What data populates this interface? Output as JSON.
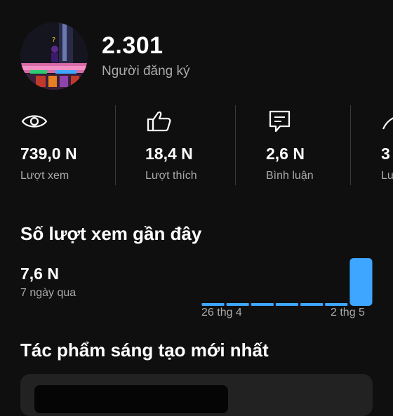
{
  "channel": {
    "subscriber_count": "2.301",
    "subscriber_label": "Người đăng ký",
    "avatar": "game-thumbnail-avatar"
  },
  "stats": [
    {
      "icon": "eye-icon",
      "value": "739,0 N",
      "label": "Lượt xem"
    },
    {
      "icon": "thumbs-up-icon",
      "value": "18,4 N",
      "label": "Lượt thích"
    },
    {
      "icon": "comment-icon",
      "value": "2,6 N",
      "label": "Bình luận"
    },
    {
      "icon": "share-icon",
      "value": "3",
      "label": "Lư"
    }
  ],
  "recent_views": {
    "title": "Số lượt xem gần đây",
    "value": "7,6 N",
    "period": "7 ngày qua",
    "x_start": "26 thg 4",
    "x_end": "2 thg 5",
    "accent_color": "#3ea6ff"
  },
  "chart_data": {
    "type": "bar",
    "categories": [
      "",
      "",
      "",
      "",
      "",
      "",
      ""
    ],
    "values": [
      0.2,
      0.2,
      0.2,
      0.2,
      0.2,
      0.2,
      7.6
    ],
    "x_tick_labels": [
      "26 thg 4",
      "2 thg 5"
    ],
    "title": "",
    "xlabel": "",
    "ylabel": "",
    "grid": false,
    "legend": "none"
  },
  "latest": {
    "title": "Tác phẩm sáng tạo mới nhất"
  }
}
